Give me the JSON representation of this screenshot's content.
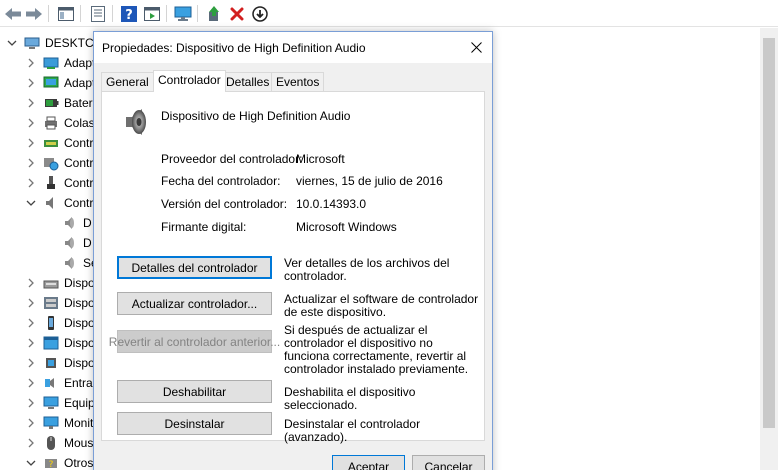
{
  "tree": {
    "root_label": "DESKTC",
    "items": [
      {
        "label": "Adapt",
        "icon": "network-adapter-icon"
      },
      {
        "label": "Adapt",
        "icon": "display-adapter-icon"
      },
      {
        "label": "Bater",
        "icon": "battery-icon"
      },
      {
        "label": "Colas",
        "icon": "print-queue-icon"
      },
      {
        "label": "Contr",
        "icon": "ide-controller-icon"
      },
      {
        "label": "Contr",
        "icon": "storage-controller-icon"
      },
      {
        "label": "Contr",
        "icon": "usb-controller-icon"
      },
      {
        "label": "Contr",
        "icon": "sound-controller-icon"
      },
      {
        "label": "D",
        "icon": "speaker-icon"
      },
      {
        "label": "D",
        "icon": "speaker-icon"
      },
      {
        "label": "Se",
        "icon": "speaker-icon"
      },
      {
        "label": "Dispo",
        "icon": "hid-device-icon"
      },
      {
        "label": "Dispo",
        "icon": "system-device-icon"
      },
      {
        "label": "Dispo",
        "icon": "portable-device-icon"
      },
      {
        "label": "Dispo",
        "icon": "software-device-icon"
      },
      {
        "label": "Dispo",
        "icon": "chip-device-icon"
      },
      {
        "label": "Entra",
        "icon": "audio-input-icon"
      },
      {
        "label": "Equip",
        "icon": "computer-icon"
      },
      {
        "label": "Monit",
        "icon": "monitor-icon"
      },
      {
        "label": "Mous",
        "icon": "mouse-icon"
      },
      {
        "label": "Otros",
        "icon": "other-devices-icon"
      }
    ]
  },
  "dialog": {
    "title": "Propiedades: Dispositivo de High Definition Audio",
    "tabs": [
      "General",
      "Controlador",
      "Detalles",
      "Eventos"
    ],
    "active_tab": "Controlador",
    "device_name": "Dispositivo de High Definition Audio",
    "properties": [
      {
        "label": "Proveedor del controlador:",
        "value": "Microsoft"
      },
      {
        "label": "Fecha del controlador:",
        "value": "viernes, 15 de julio de 2016"
      },
      {
        "label": "Versión del controlador:",
        "value": "10.0.14393.0"
      },
      {
        "label": "Firmante digital:",
        "value": "Microsoft Windows"
      }
    ],
    "actions": [
      {
        "button": "Detalles del controlador",
        "description": "Ver detalles de los archivos del controlador."
      },
      {
        "button": "Actualizar controlador...",
        "description": "Actualizar el software de controlador de este dispositivo."
      },
      {
        "button": "Revertir al controlador anterior...",
        "description": "Si después de actualizar el controlador el dispositivo no funciona correctamente, revertir al controlador instalado previamente."
      },
      {
        "button": "Deshabilitar",
        "description": "Deshabilita el dispositivo seleccionado."
      },
      {
        "button": "Desinstalar",
        "description": "Desinstalar el controlador (avanzado)."
      }
    ],
    "ok_label": "Aceptar",
    "cancel_label": "Cancelar"
  },
  "colors": {
    "accent": "#0078d7",
    "close_red": "#e81123",
    "green_arrow": "#2e9e3f"
  }
}
